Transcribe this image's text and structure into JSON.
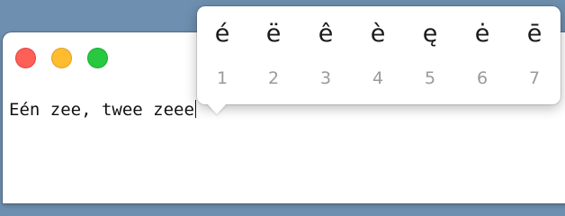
{
  "window": {
    "traffic_lights": {
      "close_color": "#fe5f57",
      "minimize_color": "#febc2e",
      "zoom_color": "#28c840"
    }
  },
  "editor": {
    "text": "Eén zee, twee zeee"
  },
  "accent_popover": {
    "options": [
      {
        "char": "é",
        "key": "1"
      },
      {
        "char": "ë",
        "key": "2"
      },
      {
        "char": "ê",
        "key": "3"
      },
      {
        "char": "è",
        "key": "4"
      },
      {
        "char": "ę",
        "key": "5"
      },
      {
        "char": "ė",
        "key": "6"
      },
      {
        "char": "ē",
        "key": "7"
      }
    ]
  }
}
